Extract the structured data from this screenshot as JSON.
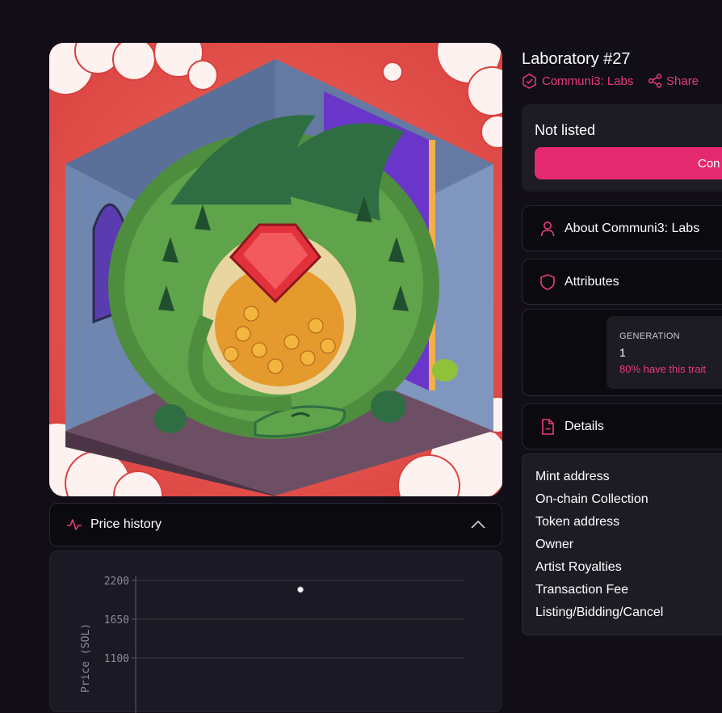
{
  "nft": {
    "title": "Laboratory #27",
    "collection": "Communi3: Labs",
    "share_label": "Share"
  },
  "listing": {
    "status": "Not listed",
    "cta_label": "Con"
  },
  "price_history": {
    "label": "Price history",
    "ylabel": "Price (SOL)",
    "yticks": [
      "2200",
      "1650",
      "1100"
    ]
  },
  "chart_data": {
    "type": "scatter",
    "title": "",
    "xlabel": "",
    "ylabel": "Price (SOL)",
    "ylim": [
      550,
      2200
    ],
    "yticks": [
      2200,
      1650,
      1100
    ],
    "series": [
      {
        "values": [
          2070
        ]
      }
    ]
  },
  "sections": {
    "about_label": "About Communi3: Labs",
    "attributes_label": "Attributes",
    "details_label": "Details"
  },
  "traits": [
    {
      "name": "GENERATION",
      "value": "1",
      "rarity": "80% have this trait"
    }
  ],
  "details": [
    "Mint address",
    "On-chain Collection",
    "Token address",
    "Owner",
    "Artist Royalties",
    "Transaction Fee",
    "Listing/Bidding/Cancel"
  ],
  "colors": {
    "accent": "#e93a7d",
    "button": "#e5296f",
    "background": "#120e18",
    "panel": "#1d1b24"
  },
  "icons": {
    "collection": "verified-badge-icon",
    "share": "share-icon",
    "price_history": "activity-icon",
    "collapse": "chevron-up-icon",
    "about": "user-icon",
    "attributes": "shield-icon",
    "details": "document-icon"
  }
}
